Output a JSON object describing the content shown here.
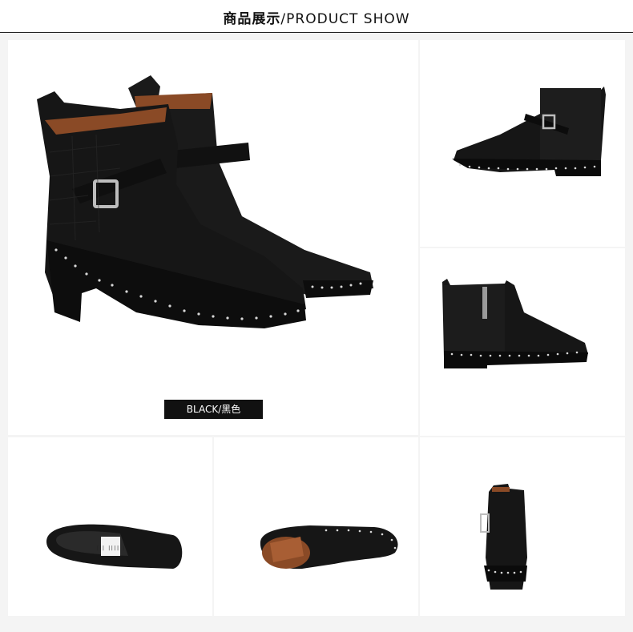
{
  "header": {
    "title_cn": "商品展示",
    "title_sep": "/",
    "title_en": "PRODUCT SHOW"
  },
  "main_label": "BLACK/黑色",
  "barcode_text": "||| |||| |",
  "colors": {
    "leather": "#161616",
    "lining": "#8a4a26",
    "stud": "#d8d8d8",
    "background": "#f4f4f4"
  }
}
